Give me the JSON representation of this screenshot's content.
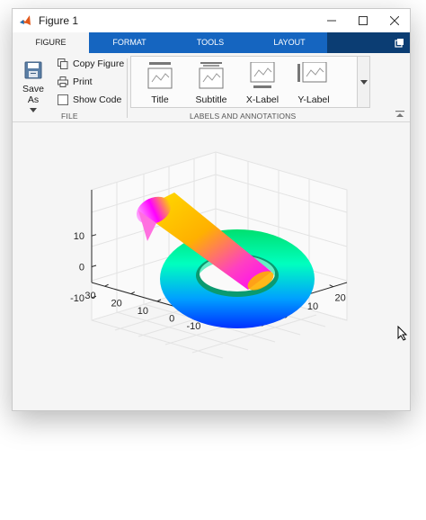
{
  "window": {
    "title": "Figure 1"
  },
  "tabs": [
    {
      "label": "FIGURE",
      "active": true
    },
    {
      "label": "FORMAT",
      "active": false
    },
    {
      "label": "TOOLS",
      "active": false
    },
    {
      "label": "LAYOUT",
      "active": false
    }
  ],
  "file_panel": {
    "save_as": "Save As",
    "copy_figure": "Copy Figure",
    "print": "Print",
    "show_code": "Show Code",
    "label": "FILE"
  },
  "labels_panel": {
    "title": "Title",
    "subtitle": "Subtitle",
    "xlabel": "X-Label",
    "ylabel": "Y-Label",
    "label": "LABELS AND ANNOTATIONS"
  },
  "colors": {
    "tab_blue": "#1565c0",
    "tab_dark": "#0b3d73"
  },
  "chart_data": {
    "type": "surface",
    "title": "",
    "xlabel": "",
    "ylabel": "",
    "zlabel": "",
    "x_ticks": [
      -10,
      0,
      10,
      20
    ],
    "y_ticks": [
      -10,
      0,
      10,
      20,
      30
    ],
    "z_ticks": [
      -10,
      0,
      10
    ],
    "xlim": [
      -20,
      25
    ],
    "ylim": [
      -15,
      35
    ],
    "zlim": [
      -15,
      15
    ],
    "grid": true,
    "colormap": "hsv",
    "surfaces": [
      {
        "name": "torus",
        "R": 10,
        "r": 3,
        "center": [
          0,
          0,
          0
        ]
      },
      {
        "name": "cylinder",
        "radius": 3,
        "from": [
          0,
          0,
          0
        ],
        "to": [
          -10,
          25,
          8
        ]
      }
    ]
  }
}
